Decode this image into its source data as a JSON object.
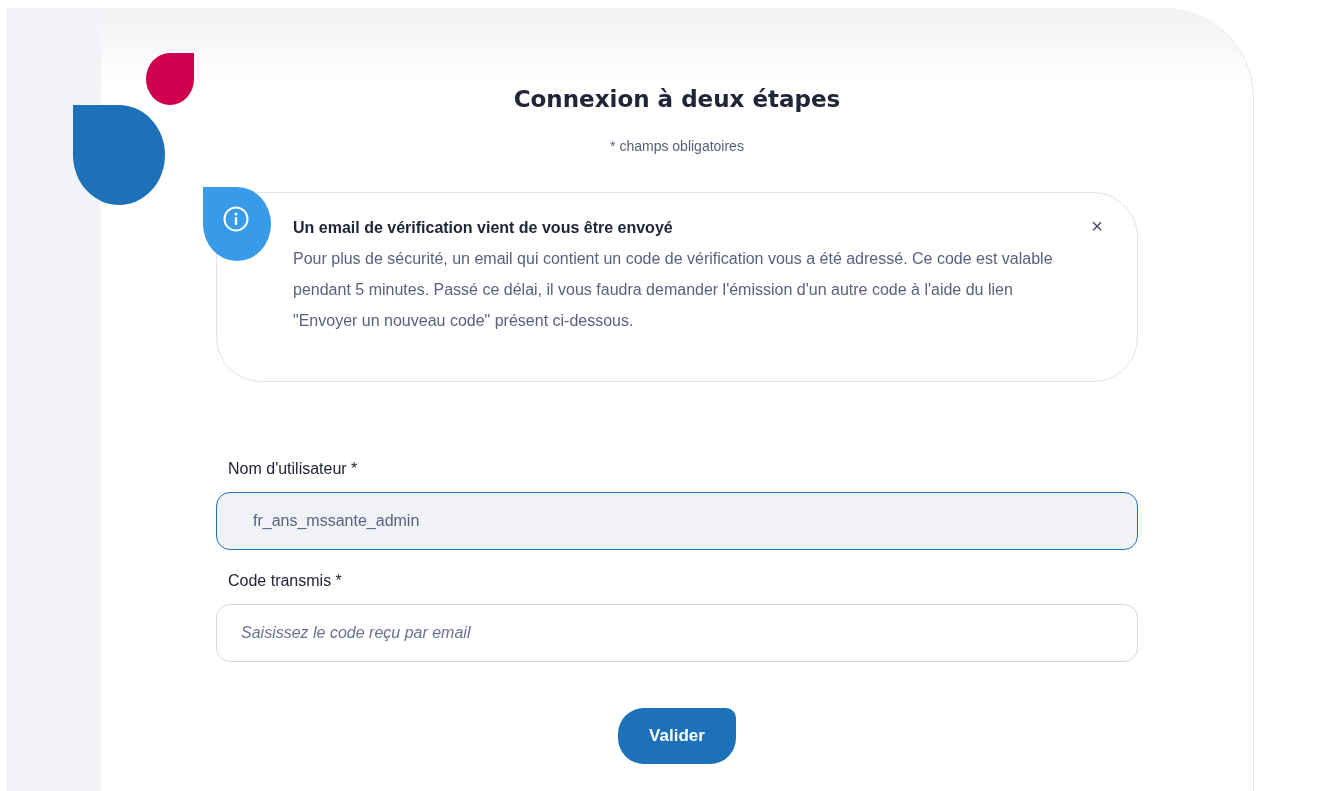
{
  "title": "Connexion à deux étapes",
  "required_note": "* champs obligatoires",
  "alert": {
    "title": "Un email de vérification vient de vous être envoyé",
    "body": "Pour plus de sécurité, un email qui contient un code de vérification vous a été adressé. Ce code est valable pendant 5 minutes. Passé ce délai, il vous faudra demander l'émission d'un autre code à l'aide du lien \"Envoyer un nouveau code\" présent ci-dessous.",
    "close": "×"
  },
  "fields": [
    {
      "label": "Nom d'utilisateur  *",
      "value": "fr_ans_mssante_admin",
      "focused": true
    },
    {
      "label": "Code transmis *",
      "placeholder": "Saisissez le code reçu par email",
      "focused": false
    }
  ],
  "submit": "Valider"
}
